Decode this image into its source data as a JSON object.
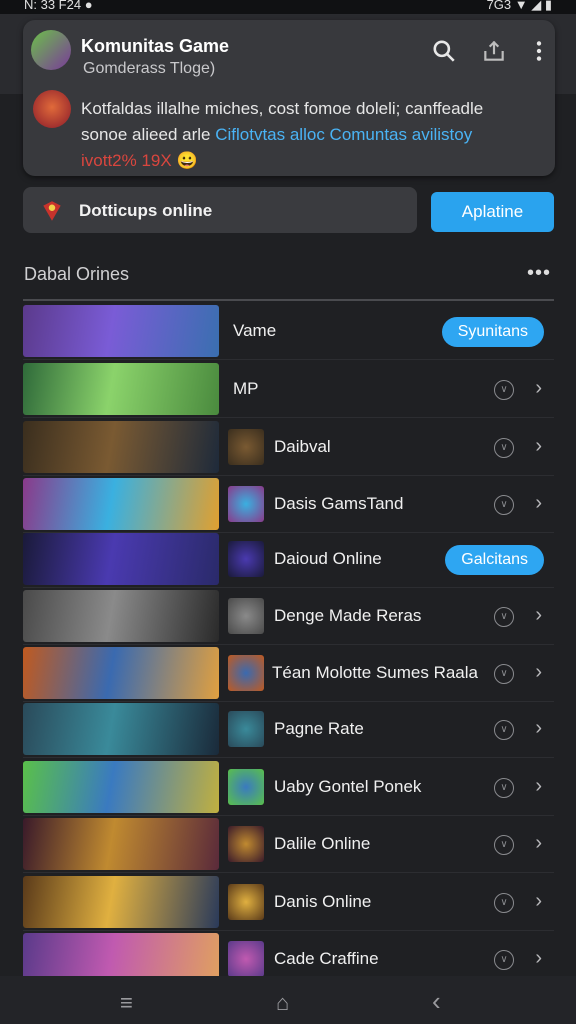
{
  "status_bar": {
    "left": "N: 33  F24  ●",
    "right": "7G3 ▼ ◢ ▮"
  },
  "card": {
    "title": "Komunitas Game",
    "subtitle": "Gomderass Tloge)",
    "message_line1": "Kotfaldas illalhe miches, cost fomoe doleli; canffeadle",
    "message_line2_a": "sonoe alieed arle ",
    "message_line2_link": "Ciflotvtas alloc Comuntas avilistoy",
    "message_line3_red": "ivott2% 19X",
    "emoji": "😀"
  },
  "status_label": "Dotticups online",
  "update_button": "Aplatine",
  "section_title": "Dabal Orines",
  "more_label": "•••",
  "rows": [
    {
      "label": "Vame",
      "pill": "Syunitans",
      "colors": [
        "#5b3a8c",
        "#7a5cd6",
        "#3a6fb0"
      ]
    },
    {
      "label": "MP",
      "pill": "",
      "colors": [
        "#2f6a3a",
        "#8bd36b",
        "#4a8a3e"
      ]
    },
    {
      "label": "Daibval",
      "pill": "",
      "colors": [
        "#3a2e1e",
        "#7a5a32",
        "#1e2a3a"
      ]
    },
    {
      "label": "Dasis GamsTand",
      "pill": "",
      "colors": [
        "#8a3a8a",
        "#3ab0e0",
        "#e0a030"
      ]
    },
    {
      "label": "Daioud Online",
      "pill": "Galcitans",
      "colors": [
        "#1a1a3a",
        "#4a3ab0",
        "#2a2a6a"
      ]
    },
    {
      "label": "Denge Made Reras",
      "pill": "",
      "colors": [
        "#4a4a4a",
        "#8a8a8a",
        "#2a2a2a"
      ]
    },
    {
      "label": "Téan Molotte Sumes Raala",
      "pill": "",
      "colors": [
        "#c05a20",
        "#3a6ab0",
        "#e0a040"
      ]
    },
    {
      "label": "Pagne Rate",
      "pill": "",
      "colors": [
        "#2a4a5a",
        "#3a8a9a",
        "#1a2a3a"
      ]
    },
    {
      "label": "Uaby Gontel Ponek",
      "pill": "",
      "colors": [
        "#5ac04a",
        "#3a7ac0",
        "#c0b040"
      ]
    },
    {
      "label": "Dalile Online",
      "pill": "",
      "colors": [
        "#3a1a2a",
        "#c08a30",
        "#5a2a3a"
      ]
    },
    {
      "label": "Danis Online",
      "pill": "",
      "colors": [
        "#5a3a1a",
        "#e0b040",
        "#2a3a5a"
      ]
    },
    {
      "label": "Cade Craffine",
      "pill": "",
      "colors": [
        "#5a3a8a",
        "#c05ab0",
        "#e0a060"
      ]
    }
  ],
  "nav": {
    "menu": "≡",
    "home": "⌂",
    "back": "‹"
  }
}
